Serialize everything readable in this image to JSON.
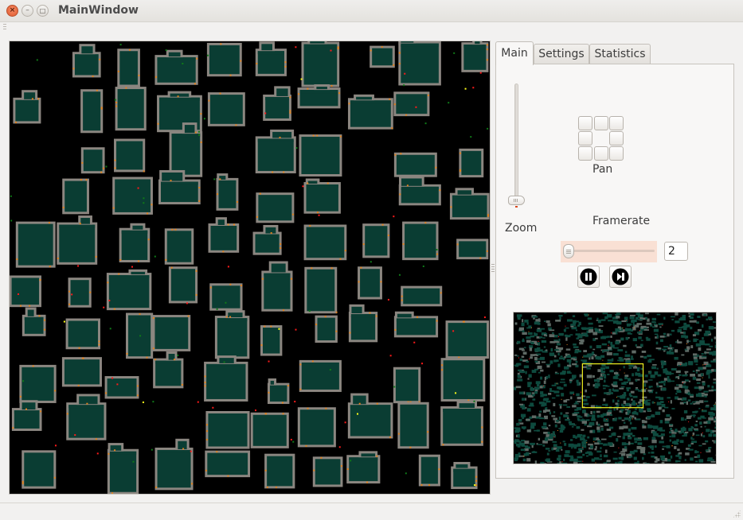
{
  "window": {
    "title": "MainWindow",
    "close_glyph": "×",
    "minimize_glyph": "–",
    "maximize_glyph": "□"
  },
  "tabs": [
    {
      "label": "Main",
      "active": true
    },
    {
      "label": "Settings",
      "active": false
    },
    {
      "label": "Statistics",
      "active": false
    }
  ],
  "main_tab": {
    "zoom_label": "Zoom",
    "zoom_value_fraction": 0.0,
    "pan_label": "Pan",
    "pan_buttons": [
      "up-left",
      "up",
      "up-right",
      "left",
      "right",
      "down-left",
      "down",
      "down-right"
    ],
    "framerate_label": "Framerate",
    "framerate_value": "2",
    "framerate_slider_fraction": 0.02,
    "pause_button_icon": "pause-icon",
    "step_button_icon": "step-forward-icon"
  },
  "colors": {
    "canvas_background": "#000000",
    "building_fill": "#0a3d33",
    "building_outline": "#8b8680",
    "door_marker": "#e0821e",
    "agent_red": "#ff1a1a",
    "agent_green": "#0f7a18",
    "agent_yellow": "#ffff1a",
    "viewport_rect": "#f0f020",
    "slider_highlight": "#f9e0d4",
    "slider_accent": "#d94a1f"
  },
  "minimap": {
    "viewport_rect_fraction": {
      "x0": 0.34,
      "y0": 0.34,
      "x1": 0.64,
      "y1": 0.63
    }
  }
}
